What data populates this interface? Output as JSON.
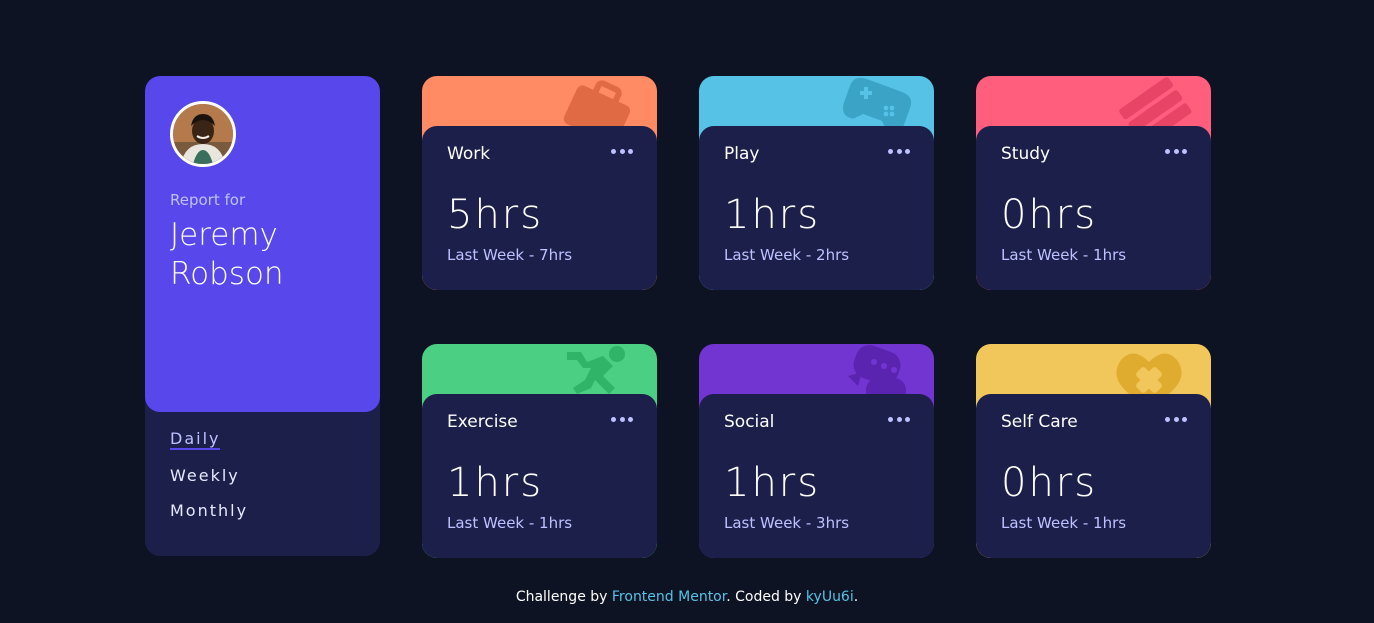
{
  "profile": {
    "report_for": "Report for",
    "name": "Jeremy Robson",
    "avatar_icon": "user-avatar-photo",
    "accent": "#5847eb"
  },
  "periods": [
    {
      "label": "Daily",
      "active": true
    },
    {
      "label": "Weekly",
      "active": false
    },
    {
      "label": "Monthly",
      "active": false
    }
  ],
  "activities": [
    {
      "title": "Work",
      "current": "5hrs",
      "previous": "Last Week - 7hrs",
      "color": "#ff8b64",
      "icon": "briefcase-icon"
    },
    {
      "title": "Play",
      "current": "1hrs",
      "previous": "Last Week - 2hrs",
      "color": "#55c2e6",
      "icon": "gamepad-icon"
    },
    {
      "title": "Study",
      "current": "0hrs",
      "previous": "Last Week - 1hrs",
      "color": "#ff5e7d",
      "icon": "books-icon"
    },
    {
      "title": "Exercise",
      "current": "1hrs",
      "previous": "Last Week - 1hrs",
      "color": "#4bcf82",
      "icon": "runner-icon"
    },
    {
      "title": "Social",
      "current": "1hrs",
      "previous": "Last Week - 3hrs",
      "color": "#7335d2",
      "icon": "chat-bubble-icon"
    },
    {
      "title": "Self Care",
      "current": "0hrs",
      "previous": "Last Week - 1hrs",
      "color": "#f1c65b",
      "icon": "heart-bandage-icon"
    }
  ],
  "footer": {
    "prefix": "Challenge by ",
    "link1": "Frontend Mentor",
    "middle": ". Coded by ",
    "link2": "kyUu6i",
    "suffix": "."
  }
}
